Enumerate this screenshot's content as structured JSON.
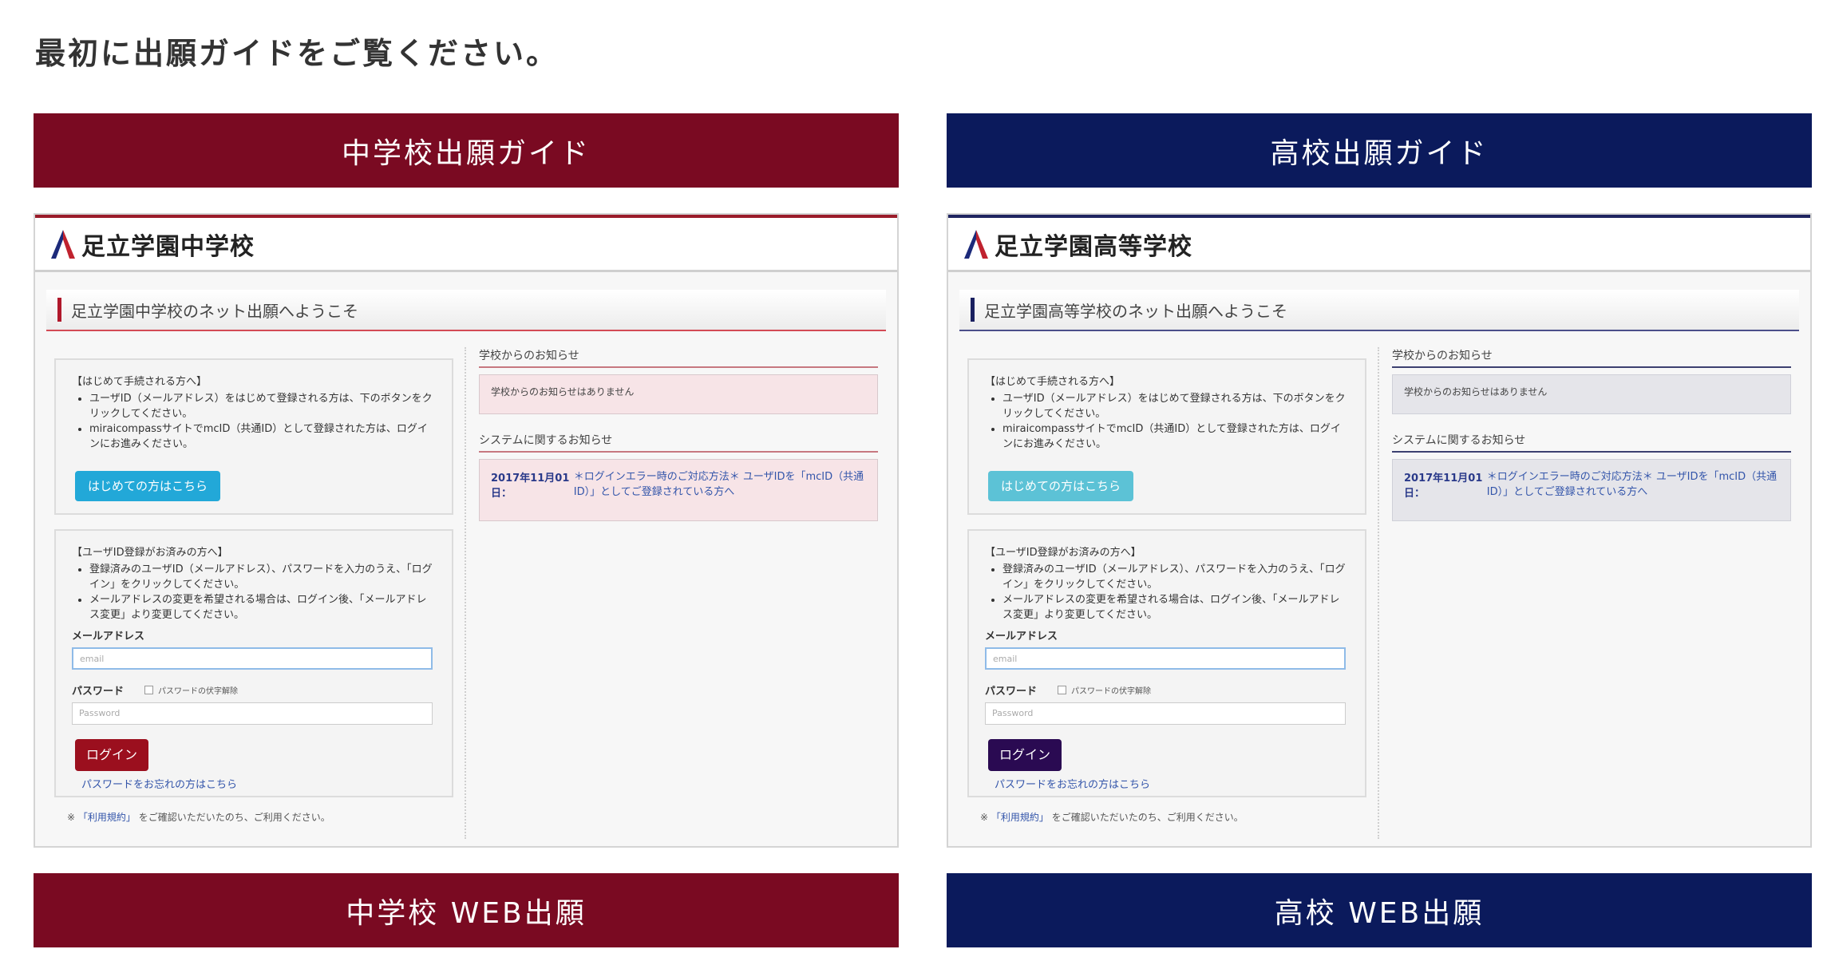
{
  "intro": "最初に出願ガイドをご覧ください。",
  "columns": {
    "jh": {
      "guide_button": "中学校出願ガイド",
      "web_button": "中学校 WEB出願",
      "shot": {
        "school_name": "足立学園中学校",
        "welcome": "足立学園中学校のネット出願へようこそ",
        "box1_title": "【はじめて手続される方へ】",
        "box1_items": [
          "ユーザID（メールアドレス）をはじめて登録される方は、下のボタンをクリックしてください。",
          "miraicompassサイトでmcID（共通ID）として登録された方は、ログインにお進みください。"
        ],
        "first_button": "はじめての方はこちら",
        "box2_title": "【ユーザID登録がお済みの方へ】",
        "box2_items": [
          "登録済みのユーザID（メールアドレス）、パスワードを入力のうえ、「ログイン」をクリックしてください。",
          "メールアドレスの変更を希望される場合は、ログイン後、「メールアドレス変更」より変更してください。"
        ],
        "email_label": "メールアドレス",
        "email_placeholder": "email",
        "password_label": "パスワード",
        "password_toggle": "パスワードの伏字解除",
        "password_placeholder": "Password",
        "login_button": "ログイン",
        "forgot_link": "パスワードをお忘れの方はこちら",
        "terms_prefix": "※",
        "terms_link": "「利用規約」",
        "terms_suffix": "をご確認いただいたのち、ご利用ください。",
        "school_news_title": "学校からのお知らせ",
        "school_news_empty": "学校からのお知らせはありません",
        "system_news_title": "システムに関するお知らせ",
        "system_news_date": "2017年11月01日：",
        "system_news_link": "＊ログインエラー時のご対応方法＊ ユーザIDを「mcID（共通ID）」としてご登録されている方へ"
      }
    },
    "hs": {
      "guide_button": "高校出願ガイド",
      "web_button": "高校 WEB出願",
      "shot": {
        "school_name": "足立学園高等学校",
        "welcome": "足立学園高等学校のネット出願へようこそ",
        "box1_title": "【はじめて手続される方へ】",
        "box1_items": [
          "ユーザID（メールアドレス）をはじめて登録される方は、下のボタンをクリックしてください。",
          "miraicompassサイトでmcID（共通ID）として登録された方は、ログインにお進みください。"
        ],
        "first_button": "はじめての方はこちら",
        "box2_title": "【ユーザID登録がお済みの方へ】",
        "box2_items": [
          "登録済みのユーザID（メールアドレス）、パスワードを入力のうえ、「ログイン」をクリックしてください。",
          "メールアドレスの変更を希望される場合は、ログイン後、「メールアドレス変更」より変更してください。"
        ],
        "email_label": "メールアドレス",
        "email_placeholder": "email",
        "password_label": "パスワード",
        "password_toggle": "パスワードの伏字解除",
        "password_placeholder": "Password",
        "login_button": "ログイン",
        "forgot_link": "パスワードをお忘れの方はこちら",
        "terms_prefix": "※",
        "terms_link": "「利用規約」",
        "terms_suffix": "をご確認いただいたのち、ご利用ください。",
        "school_news_title": "学校からのお知らせ",
        "school_news_empty": "学校からのお知らせはありません",
        "system_news_title": "システムに関するお知らせ",
        "system_news_date": "2017年11月01日：",
        "system_news_link": "＊ログインエラー時のご対応方法＊ ユーザIDを「mcID（共通ID）」としてご登録されている方へ"
      }
    }
  },
  "colors": {
    "junior_high_accent": "#7a0a22",
    "high_school_accent": "#0b1a5c"
  },
  "icons": {
    "logo": "adachi-a-logo-icon"
  }
}
